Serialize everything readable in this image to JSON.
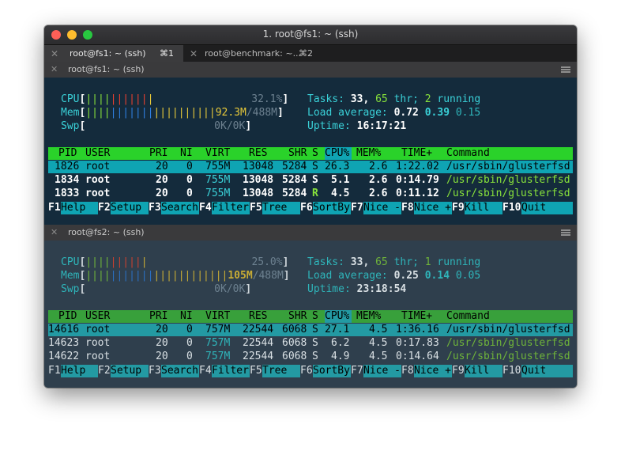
{
  "window": {
    "title": "1. root@fs1: ~ (ssh)"
  },
  "tabs": [
    {
      "close": "✕",
      "label": "root@fs1: ~ (ssh)",
      "shortcut": "⌘1"
    },
    {
      "close": "✕",
      "label": "root@benchmark: ~...",
      "shortcut": "⌘2"
    }
  ],
  "panes": [
    {
      "header": "root@fs1: ~ (ssh)",
      "cpu": {
        "label": "CPU",
        "bars_green": "||||",
        "bars_red": "||||||",
        "bars_yellow": "|",
        "value": "32.1%"
      },
      "mem": {
        "label": "Mem",
        "bars_green": "||||",
        "bars_blue": "|||||||",
        "bars_yellow": "||||||||||",
        "value": "92.3M",
        "total": "488M"
      },
      "swp": {
        "label": "Swp",
        "value": "0K",
        "total": "0K"
      },
      "tasks": {
        "label": "Tasks:",
        "count": "33,",
        "thr": "65",
        "thr_label": "thr;",
        "running": "2",
        "running_label": "running"
      },
      "load": {
        "label": "Load average:",
        "v1": "0.72",
        "v2": "0.39",
        "v3": "0.15"
      },
      "uptime": {
        "label": "Uptime:",
        "value": "16:17:21"
      },
      "rows": [
        {
          "pid": "1826",
          "user": "root",
          "pri": "20",
          "ni": "0",
          "virt": "755M",
          "res": "13048",
          "shr": "5284",
          "s": "S",
          "cpu": "26.3",
          "mem": "2.6",
          "time": "1:22.02",
          "cmd": "/usr/sbin/glusterfsd"
        },
        {
          "pid": "1834",
          "user": "root",
          "pri": "20",
          "ni": "0",
          "virt": "755M",
          "res": "13048",
          "shr": "5284",
          "s": "S",
          "cpu": "5.1",
          "mem": "2.6",
          "time": "0:14.79",
          "cmd": "/usr/sbin/glusterfsd"
        },
        {
          "pid": "1833",
          "user": "root",
          "pri": "20",
          "ni": "0",
          "virt": "755M",
          "res": "13048",
          "shr": "5284",
          "s": "R",
          "cpu": "4.5",
          "mem": "2.6",
          "time": "0:11.12",
          "cmd": "/usr/sbin/glusterfsd"
        }
      ]
    },
    {
      "header": "root@fs2: ~ (ssh)",
      "cpu": {
        "label": "CPU",
        "bars_green": "||||",
        "bars_red": "|||||",
        "bars_yellow": "|",
        "value": "25.0%"
      },
      "mem": {
        "label": "Mem",
        "bars_green": "||||",
        "bars_blue": "|||||||",
        "bars_yellow": "||||||||||||",
        "value": "105M",
        "total": "488M"
      },
      "swp": {
        "label": "Swp",
        "value": "0K",
        "total": "0K"
      },
      "tasks": {
        "label": "Tasks:",
        "count": "33,",
        "thr": "65",
        "thr_label": "thr;",
        "running": "1",
        "running_label": "running"
      },
      "load": {
        "label": "Load average:",
        "v1": "0.25",
        "v2": "0.14",
        "v3": "0.05"
      },
      "uptime": {
        "label": "Uptime:",
        "value": "23:18:54"
      },
      "rows": [
        {
          "pid": "14616",
          "user": "root",
          "pri": "20",
          "ni": "0",
          "virt": "757M",
          "res": "22544",
          "shr": "6068",
          "s": "S",
          "cpu": "27.1",
          "mem": "4.5",
          "time": "1:36.16",
          "cmd": "/usr/sbin/glusterfsd"
        },
        {
          "pid": "14623",
          "user": "root",
          "pri": "20",
          "ni": "0",
          "virt": "757M",
          "res": "22544",
          "shr": "6068",
          "s": "S",
          "cpu": "6.2",
          "mem": "4.5",
          "time": "0:17.83",
          "cmd": "/usr/sbin/glusterfsd"
        },
        {
          "pid": "14622",
          "user": "root",
          "pri": "20",
          "ni": "0",
          "virt": "757M",
          "res": "22544",
          "shr": "6068",
          "s": "S",
          "cpu": "4.9",
          "mem": "4.5",
          "time": "0:14.64",
          "cmd": "/usr/sbin/glusterfsd"
        }
      ]
    }
  ],
  "columns": {
    "pid": "PID",
    "user": "USER",
    "pri": "PRI",
    "ni": "NI",
    "virt": "VIRT",
    "res": "RES",
    "shr": "SHR",
    "s": "S",
    "cpu": "CPU%",
    "mem": "MEM%",
    "time": "TIME+",
    "cmd": "Command"
  },
  "fkeys": [
    {
      "key": "F1",
      "label": "Help"
    },
    {
      "key": "F2",
      "label": "Setup"
    },
    {
      "key": "F3",
      "label": "Search"
    },
    {
      "key": "F4",
      "label": "Filter"
    },
    {
      "key": "F5",
      "label": "Tree"
    },
    {
      "key": "F6",
      "label": "SortBy"
    },
    {
      "key": "F7",
      "label": "Nice -"
    },
    {
      "key": "F8",
      "label": "Nice +"
    },
    {
      "key": "F9",
      "label": "Kill"
    },
    {
      "key": "F10",
      "label": "Quit"
    }
  ],
  "colors": {
    "header_green": "#2ad22a",
    "selection_cyan": "#0fa4b3",
    "cyan_text": "#3ad1d8",
    "command_green": "#88e23b"
  }
}
